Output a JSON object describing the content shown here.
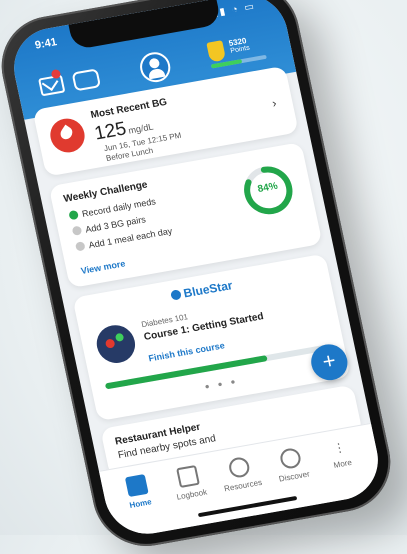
{
  "status": {
    "time": "9:41"
  },
  "header": {
    "points_value": "5320",
    "points_label": "Points",
    "points_progress": 0.55
  },
  "bg_card": {
    "title": "Most Recent BG",
    "value": "125",
    "unit": "mg/dL",
    "date": "Jun 16, Tue 12:15 PM",
    "meal": "Before Lunch"
  },
  "weekly": {
    "title": "Weekly Challenge",
    "items": [
      {
        "label": "Record daily meds",
        "done": true
      },
      {
        "label": "Add 3 BG pairs",
        "done": false
      },
      {
        "label": "Add 1 meal each day",
        "done": false
      }
    ],
    "view_more": "View more",
    "percent_label": "84%",
    "percent_value": 0.84
  },
  "course": {
    "brand": "BlueStar",
    "subtitle": "Diabetes 101",
    "title": "Course 1: Getting Started",
    "cta": "Finish this course",
    "progress": 0.72,
    "pager": "● ● ●"
  },
  "fab": {
    "label": "+"
  },
  "restaurant": {
    "title": "Restaurant Helper",
    "subtitle": "Find nearby spots and"
  },
  "tabs": [
    {
      "label": "Home",
      "icon": "home-icon",
      "active": true
    },
    {
      "label": "Logbook",
      "icon": "logbook-icon",
      "active": false
    },
    {
      "label": "Resources",
      "icon": "lightbulb-icon",
      "active": false
    },
    {
      "label": "Discover",
      "icon": "discover-icon",
      "active": false
    },
    {
      "label": "More",
      "icon": "more-icon",
      "active": false
    }
  ],
  "colors": {
    "brand_blue": "#1d78c8",
    "success_green": "#22a64a",
    "alert_red": "#e03a2f"
  }
}
